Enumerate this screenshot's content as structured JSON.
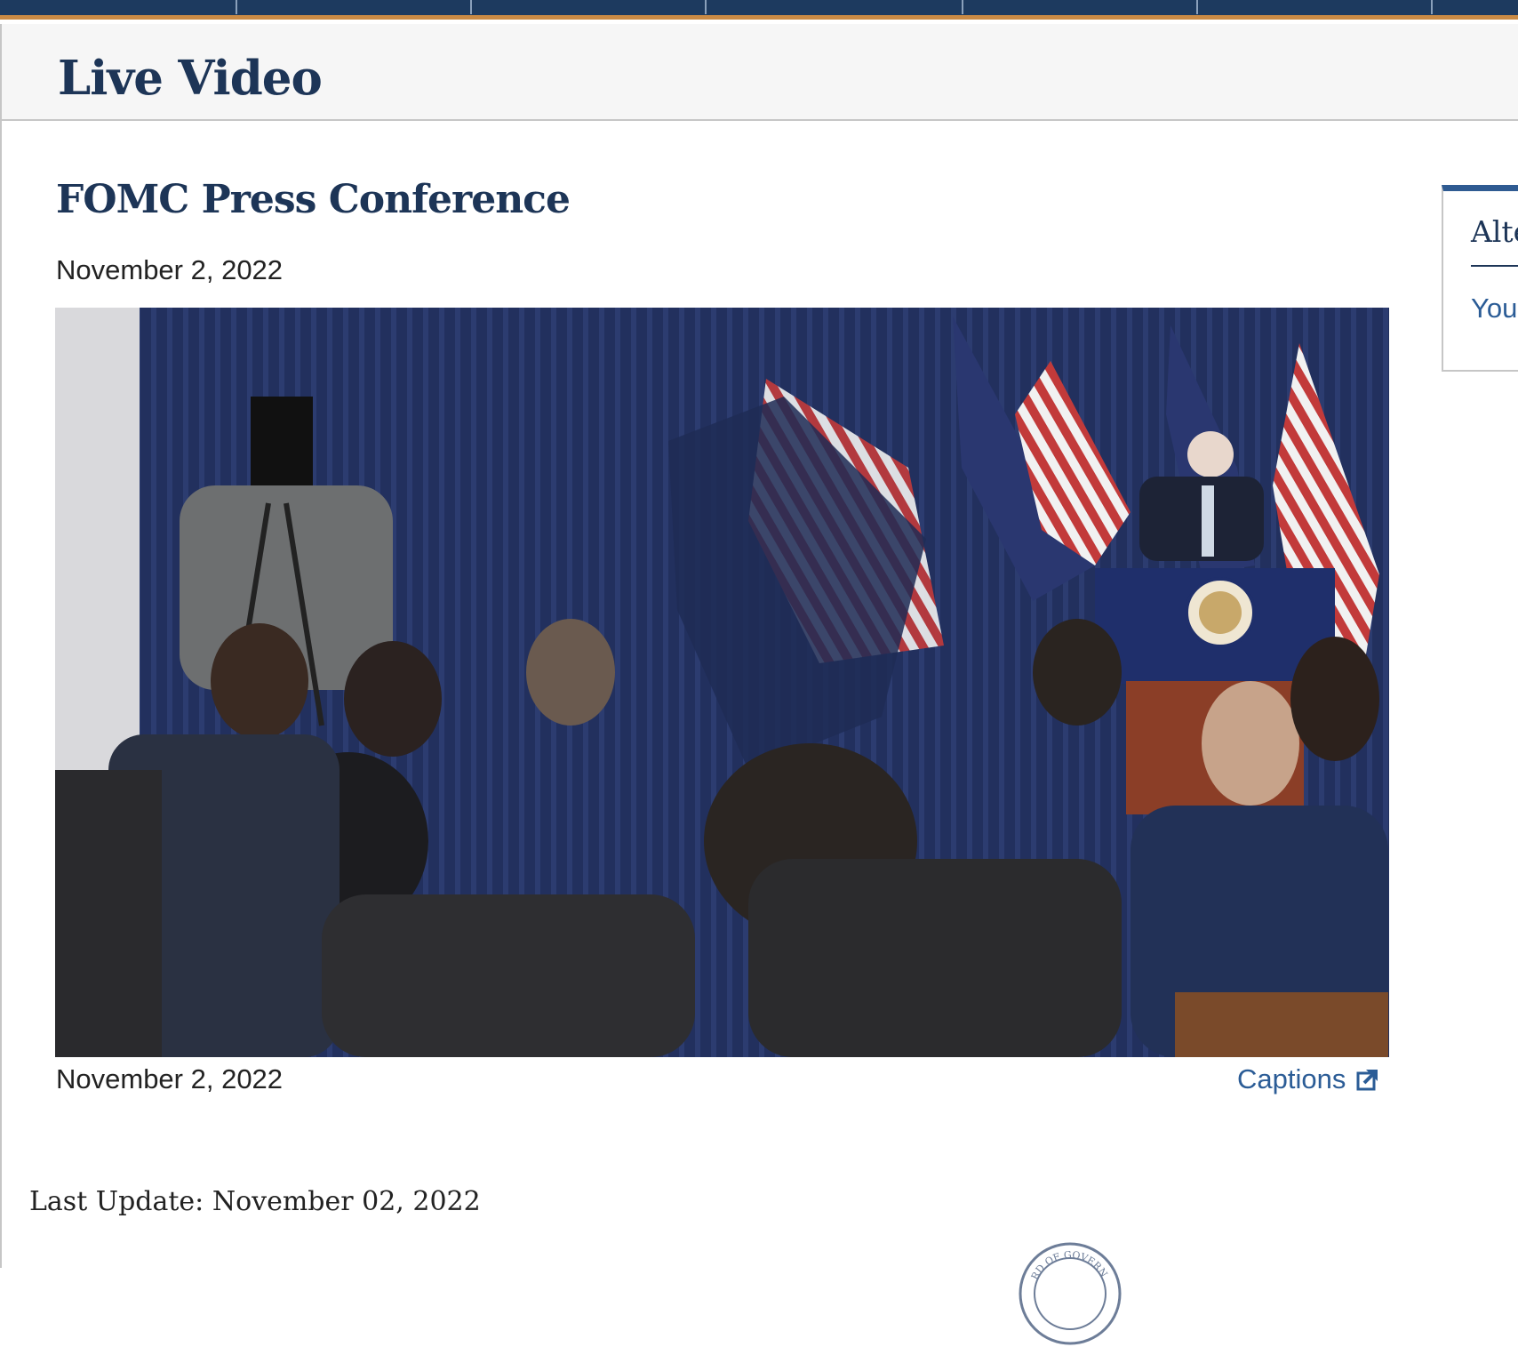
{
  "header": {
    "title": "Live Video"
  },
  "article": {
    "title": "FOMC Press Conference",
    "date": "November 2, 2022"
  },
  "video": {
    "caption_date": "November 2, 2022",
    "captions_label": "Captions"
  },
  "sidebar": {
    "title": "Alte",
    "link": "You"
  },
  "footer": {
    "last_update": "Last Update: November 02, 2022",
    "seal_text": "RD OF GOVERN"
  },
  "colors": {
    "nav_bg": "#1d3a5f",
    "nav_accent": "#c98a45",
    "heading": "#1d3557",
    "link": "#2b5c96"
  }
}
